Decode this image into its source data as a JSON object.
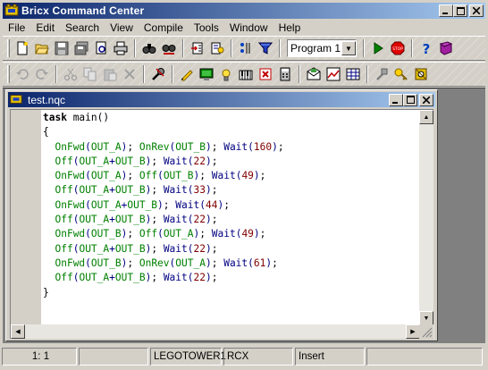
{
  "app": {
    "title": "Bricx Command Center"
  },
  "menu": [
    {
      "label": "File"
    },
    {
      "label": "Edit"
    },
    {
      "label": "Search"
    },
    {
      "label": "View"
    },
    {
      "label": "Compile"
    },
    {
      "label": "Tools"
    },
    {
      "label": "Window"
    },
    {
      "label": "Help"
    }
  ],
  "toolbar": {
    "program_select": "Program 1"
  },
  "document": {
    "title": "test.nqc",
    "lines": [
      [
        [
          "kw",
          "task"
        ],
        [
          "plain",
          " main()"
        ]
      ],
      [
        [
          "plain",
          "{"
        ]
      ],
      [
        [
          "plain",
          "  "
        ],
        [
          "fn",
          "OnFwd"
        ],
        [
          "br",
          "("
        ],
        [
          "fn",
          "OUT_A"
        ],
        [
          "br",
          ")"
        ],
        [
          "plain",
          "; "
        ],
        [
          "fn",
          "OnRev"
        ],
        [
          "br",
          "("
        ],
        [
          "fn",
          "OUT_B"
        ],
        [
          "br",
          ")"
        ],
        [
          "plain",
          "; "
        ],
        [
          "kw2",
          "Wait"
        ],
        [
          "br",
          "("
        ],
        [
          "num",
          "160"
        ],
        [
          "br",
          ")"
        ],
        [
          "plain",
          ";"
        ]
      ],
      [
        [
          "plain",
          "  "
        ],
        [
          "fn",
          "Off"
        ],
        [
          "br",
          "("
        ],
        [
          "fn",
          "OUT_A"
        ],
        [
          "br",
          "+"
        ],
        [
          "fn",
          "OUT_B"
        ],
        [
          "br",
          ")"
        ],
        [
          "plain",
          "; "
        ],
        [
          "kw2",
          "Wait"
        ],
        [
          "br",
          "("
        ],
        [
          "num",
          "22"
        ],
        [
          "br",
          ")"
        ],
        [
          "plain",
          ";"
        ]
      ],
      [
        [
          "plain",
          "  "
        ],
        [
          "fn",
          "OnFwd"
        ],
        [
          "br",
          "("
        ],
        [
          "fn",
          "OUT_A"
        ],
        [
          "br",
          ")"
        ],
        [
          "plain",
          "; "
        ],
        [
          "fn",
          "Off"
        ],
        [
          "br",
          "("
        ],
        [
          "fn",
          "OUT_B"
        ],
        [
          "br",
          ")"
        ],
        [
          "plain",
          "; "
        ],
        [
          "kw2",
          "Wait"
        ],
        [
          "br",
          "("
        ],
        [
          "num",
          "49"
        ],
        [
          "br",
          ")"
        ],
        [
          "plain",
          ";"
        ]
      ],
      [
        [
          "plain",
          "  "
        ],
        [
          "fn",
          "Off"
        ],
        [
          "br",
          "("
        ],
        [
          "fn",
          "OUT_A"
        ],
        [
          "br",
          "+"
        ],
        [
          "fn",
          "OUT_B"
        ],
        [
          "br",
          ")"
        ],
        [
          "plain",
          "; "
        ],
        [
          "kw2",
          "Wait"
        ],
        [
          "br",
          "("
        ],
        [
          "num",
          "33"
        ],
        [
          "br",
          ")"
        ],
        [
          "plain",
          ";"
        ]
      ],
      [
        [
          "plain",
          "  "
        ],
        [
          "fn",
          "OnFwd"
        ],
        [
          "br",
          "("
        ],
        [
          "fn",
          "OUT_A"
        ],
        [
          "br",
          "+"
        ],
        [
          "fn",
          "OUT_B"
        ],
        [
          "br",
          ")"
        ],
        [
          "plain",
          "; "
        ],
        [
          "kw2",
          "Wait"
        ],
        [
          "br",
          "("
        ],
        [
          "num",
          "44"
        ],
        [
          "br",
          ")"
        ],
        [
          "plain",
          ";"
        ]
      ],
      [
        [
          "plain",
          "  "
        ],
        [
          "fn",
          "Off"
        ],
        [
          "br",
          "("
        ],
        [
          "fn",
          "OUT_A"
        ],
        [
          "br",
          "+"
        ],
        [
          "fn",
          "OUT_B"
        ],
        [
          "br",
          ")"
        ],
        [
          "plain",
          "; "
        ],
        [
          "kw2",
          "Wait"
        ],
        [
          "br",
          "("
        ],
        [
          "num",
          "22"
        ],
        [
          "br",
          ")"
        ],
        [
          "plain",
          ";"
        ]
      ],
      [
        [
          "plain",
          "  "
        ],
        [
          "fn",
          "OnFwd"
        ],
        [
          "br",
          "("
        ],
        [
          "fn",
          "OUT_B"
        ],
        [
          "br",
          ")"
        ],
        [
          "plain",
          "; "
        ],
        [
          "fn",
          "Off"
        ],
        [
          "br",
          "("
        ],
        [
          "fn",
          "OUT_A"
        ],
        [
          "br",
          ")"
        ],
        [
          "plain",
          "; "
        ],
        [
          "kw2",
          "Wait"
        ],
        [
          "br",
          "("
        ],
        [
          "num",
          "49"
        ],
        [
          "br",
          ")"
        ],
        [
          "plain",
          ";"
        ]
      ],
      [
        [
          "plain",
          "  "
        ],
        [
          "fn",
          "Off"
        ],
        [
          "br",
          "("
        ],
        [
          "fn",
          "OUT_A"
        ],
        [
          "br",
          "+"
        ],
        [
          "fn",
          "OUT_B"
        ],
        [
          "br",
          ")"
        ],
        [
          "plain",
          "; "
        ],
        [
          "kw2",
          "Wait"
        ],
        [
          "br",
          "("
        ],
        [
          "num",
          "22"
        ],
        [
          "br",
          ")"
        ],
        [
          "plain",
          ";"
        ]
      ],
      [
        [
          "plain",
          "  "
        ],
        [
          "fn",
          "OnFwd"
        ],
        [
          "br",
          "("
        ],
        [
          "fn",
          "OUT_B"
        ],
        [
          "br",
          ")"
        ],
        [
          "plain",
          "; "
        ],
        [
          "fn",
          "OnRev"
        ],
        [
          "br",
          "("
        ],
        [
          "fn",
          "OUT_A"
        ],
        [
          "br",
          ")"
        ],
        [
          "plain",
          "; "
        ],
        [
          "kw2",
          "Wait"
        ],
        [
          "br",
          "("
        ],
        [
          "num",
          "61"
        ],
        [
          "br",
          ")"
        ],
        [
          "plain",
          ";"
        ]
      ],
      [
        [
          "plain",
          "  "
        ],
        [
          "fn",
          "Off"
        ],
        [
          "br",
          "("
        ],
        [
          "fn",
          "OUT_A"
        ],
        [
          "br",
          "+"
        ],
        [
          "fn",
          "OUT_B"
        ],
        [
          "br",
          ")"
        ],
        [
          "plain",
          "; "
        ],
        [
          "kw2",
          "Wait"
        ],
        [
          "br",
          "("
        ],
        [
          "num",
          "22"
        ],
        [
          "br",
          ")"
        ],
        [
          "plain",
          ";"
        ]
      ],
      [
        [
          "plain",
          "}"
        ]
      ]
    ]
  },
  "status": {
    "position": "1:  1",
    "port": "LEGOTOWER1",
    "target": "RCX",
    "mode": "Insert"
  },
  "colors": {
    "title_start": "#0a246a",
    "title_end": "#a6caf0",
    "function": "#008000",
    "number": "#800000",
    "wait": "#000080"
  }
}
